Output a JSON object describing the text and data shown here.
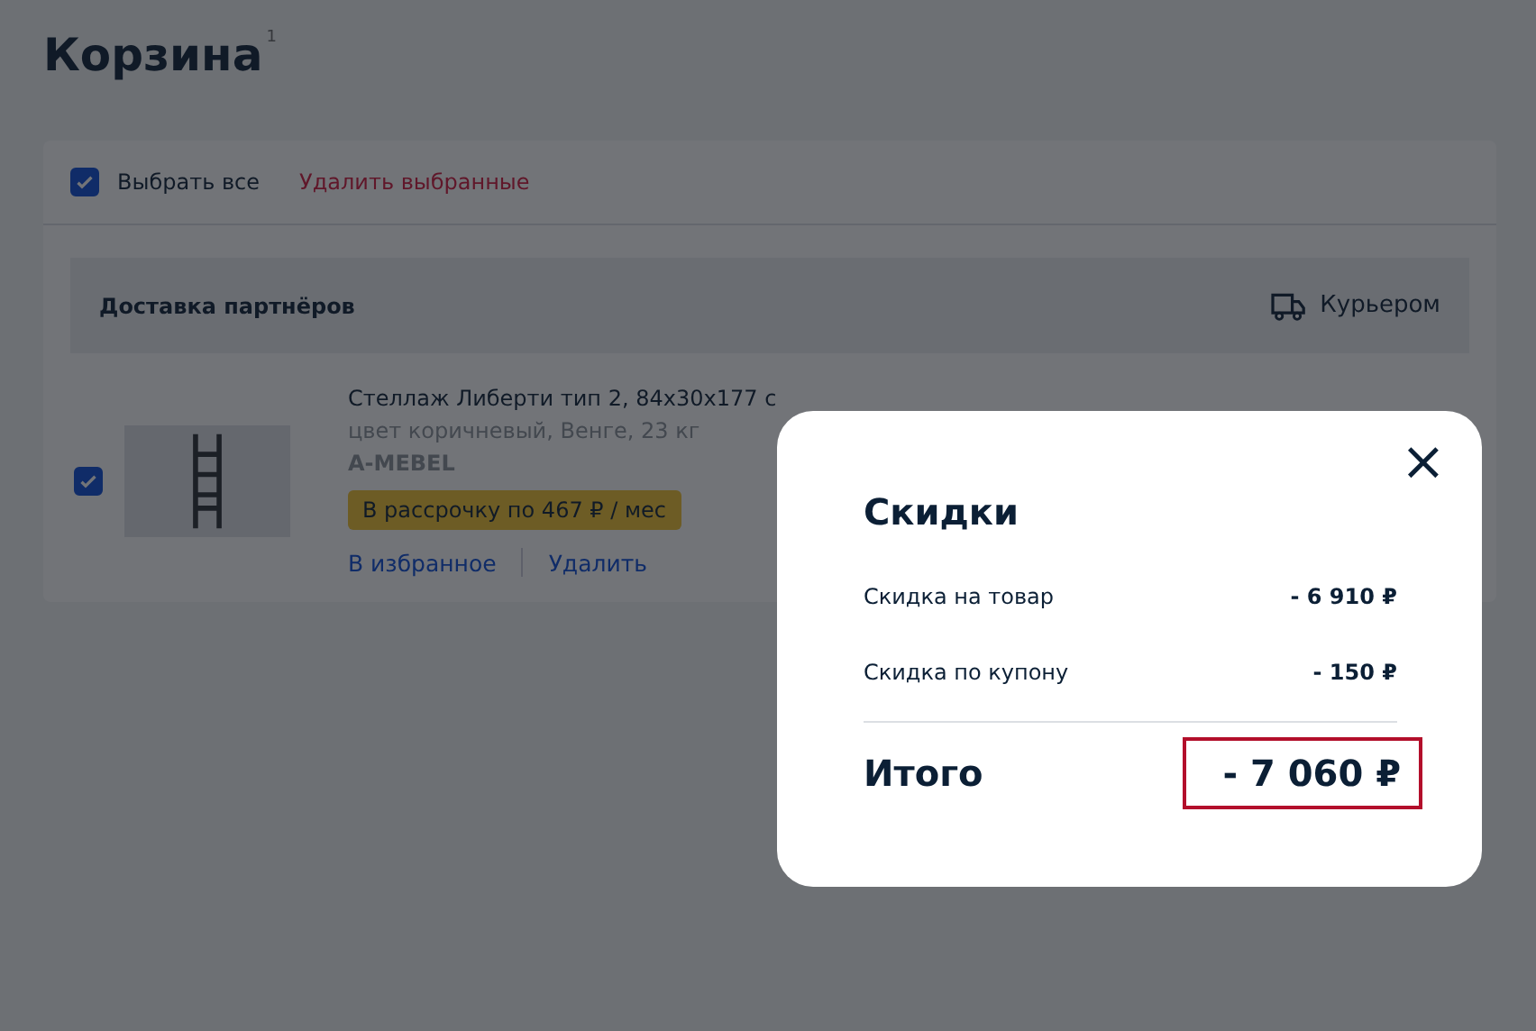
{
  "page": {
    "title": "Корзина",
    "count": "1"
  },
  "toolbar": {
    "select_all": {
      "label": "Выбрать все",
      "checked": true
    },
    "delete_selected": "Удалить выбранные"
  },
  "delivery": {
    "title": "Доставка партнёров",
    "method": "Курьером"
  },
  "items": [
    {
      "checked": true,
      "name": "Стеллаж Либерти тип 2, 84x30x177 с",
      "details": "цвет коричневый, Венге, 23 кг",
      "seller": "A-MEBEL",
      "installment": "В рассрочку по 467 ₽ / мес",
      "actions": [
        "В избранное",
        "Удалить"
      ]
    }
  ],
  "modal": {
    "title": "Скидки",
    "close": "×",
    "lines": [
      {
        "label": "Скидка на товар",
        "value": "- 6 910 ₽"
      },
      {
        "label": "Скидка по купону",
        "value": "- 150 ₽"
      }
    ],
    "total": {
      "label": "Итого",
      "value": "- 7 060 ₽",
      "highlighted": true
    }
  }
}
